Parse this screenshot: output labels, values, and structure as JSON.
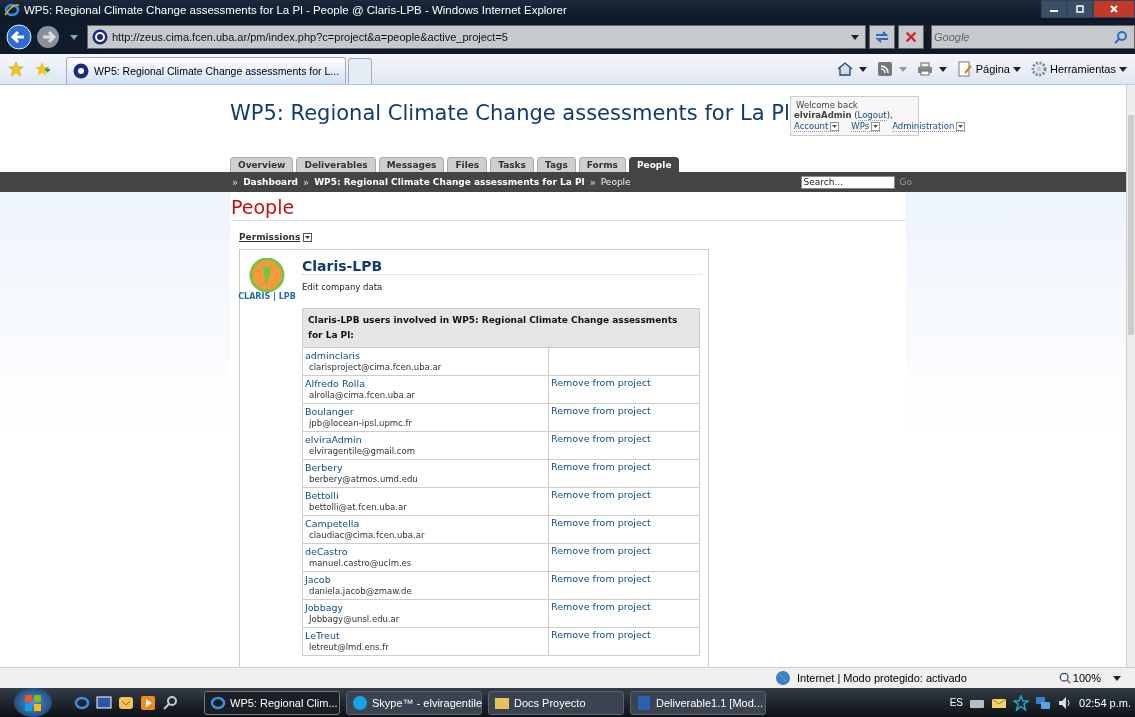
{
  "window": {
    "title": "WP5: Regional Climate Change assessments for La Pl - People @ Claris-LPB - Windows Internet Explorer"
  },
  "address_bar": {
    "url": "http://zeus.cima.fcen.uba.ar/pm/index.php?c=project&a=people&active_project=5",
    "search_placeholder": "Google"
  },
  "browser_tabs": [
    {
      "label": "WP5: Regional Climate Change assessments for L...",
      "selected": true
    }
  ],
  "command_bar": [
    "Página",
    "Herramientas"
  ],
  "page": {
    "project_title": "WP5: Regional Climate Change assessments for La Pl",
    "welcome": {
      "greeting": "Welcome back",
      "user": "elviraAdmin",
      "open_paren": "(",
      "logout": "Logout",
      "close_paren": "),",
      "menus": [
        "Account",
        "WPs",
        "Administration"
      ]
    },
    "tabs": [
      {
        "label": "Overview",
        "selected": false
      },
      {
        "label": "Deliverables",
        "selected": false
      },
      {
        "label": "Messages",
        "selected": false
      },
      {
        "label": "Files",
        "selected": false
      },
      {
        "label": "Tasks",
        "selected": false
      },
      {
        "label": "Tags",
        "selected": false
      },
      {
        "label": "Forms",
        "selected": false
      },
      {
        "label": "People",
        "selected": true
      }
    ],
    "breadcrumbs": [
      {
        "separator": "»",
        "label": "Dashboard",
        "link": true
      },
      {
        "separator": "»",
        "label": "WP5: Regional Climate Change assessments for La Pl",
        "link": true
      },
      {
        "separator": "»",
        "label": "People",
        "link": false
      }
    ],
    "search": {
      "placeholder": "Search...",
      "button": "Go"
    },
    "heading": "People",
    "permissions": "Permissions",
    "company": {
      "logo_text": "CLARIS | LPB",
      "name": "Claris-LPB",
      "edit_link": "Edit company data",
      "table_header": "Claris-LPB users involved in WP5: Regional Climate Change assessments for La Pl:",
      "users": [
        {
          "name": "adminclaris",
          "email": "clarisproject@cima.fcen.uba.ar"
        },
        {
          "name": "Alfredo Rolla",
          "email": "alrolla@cima.fcen.uba.ar",
          "action": "Remove from project"
        },
        {
          "name": "Boulanger",
          "email": "jpb@locean-ipsl.upmc.fr",
          "action": "Remove from project"
        },
        {
          "name": "elviraAdmin",
          "email": "elviragentile@gmail.com",
          "action": "Remove from project"
        },
        {
          "name": "Berbery",
          "email": "berbery@atmos.umd.edu",
          "action": "Remove from project"
        },
        {
          "name": "Bettolli",
          "email": "bettolli@at.fcen.uba.ar",
          "action": "Remove from project"
        },
        {
          "name": "Campetella",
          "email": "claudiac@cima.fcen.uba.ar",
          "action": "Remove from project"
        },
        {
          "name": "deCastro",
          "email": "manuel.castro@uclm.es",
          "action": "Remove from project"
        },
        {
          "name": "Jacob",
          "email": "daniela.jacob@zmaw.de",
          "action": "Remove from project"
        },
        {
          "name": "Jobbagy",
          "email": "Jobbagy@unsl.edu.ar",
          "action": "Remove from project"
        },
        {
          "name": "LeTreut",
          "email": "letreut@lmd.ens.fr",
          "action": "Remove from project"
        }
      ]
    }
  },
  "status_bar": {
    "zone": "Internet | Modo protegido: activado",
    "zoom": "100%"
  },
  "taskbar": {
    "tasks": [
      {
        "label": "WP5: Regional Clim...",
        "kind": "ie",
        "selected": true
      },
      {
        "label": "Skype™ - elviragentile",
        "kind": "skype",
        "selected": false
      },
      {
        "label": "Docs Proyecto",
        "kind": "folder",
        "selected": false
      },
      {
        "label": "Deliverable1.1 [Mod...",
        "kind": "word",
        "selected": false
      }
    ],
    "language": "ES",
    "clock": "02:54 p.m."
  }
}
